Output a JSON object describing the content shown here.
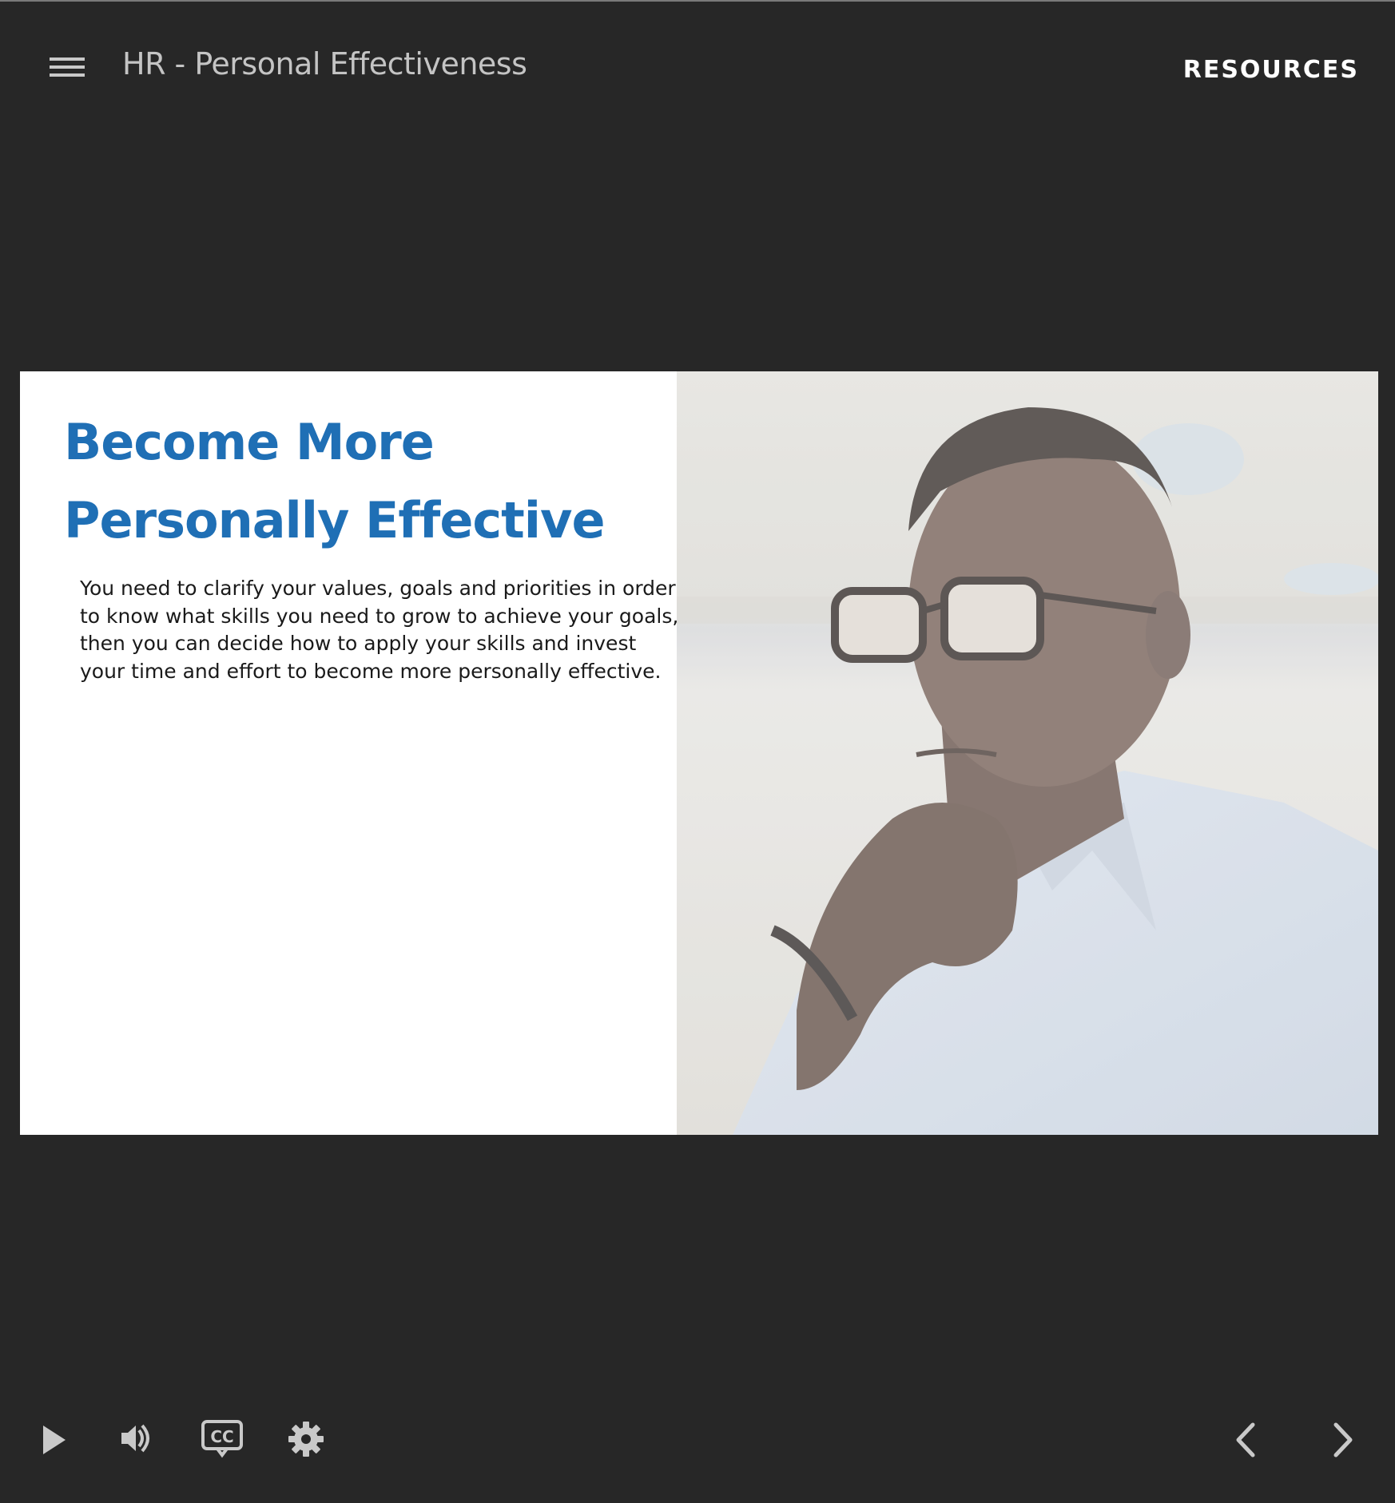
{
  "header": {
    "course_title": "HR - Personal Effectiveness",
    "resources_label": "RESOURCES",
    "menu_icon": "hamburger-menu-icon"
  },
  "slide": {
    "heading_line1": "Become More",
    "heading_line2": "Personally Effective",
    "body": "You need to clarify your values, goals and priorities in order to know what skills you need to grow to achieve your goals, then you can decide how to apply your skills and invest your time and effort to become more personally effective.",
    "photo": "man-with-glasses-thinking-photo",
    "heading_color": "#1f6fb5"
  },
  "controls": {
    "play_icon": "play-icon",
    "volume_icon": "volume-icon",
    "captions_icon": "closed-captions-icon",
    "settings_icon": "gear-icon",
    "prev_icon": "chevron-left-icon",
    "next_icon": "chevron-right-icon"
  },
  "colors": {
    "background": "#272727",
    "header_text": "#c4c4c4",
    "icon": "#c9c9c9",
    "slide_background": "#ffffff"
  }
}
